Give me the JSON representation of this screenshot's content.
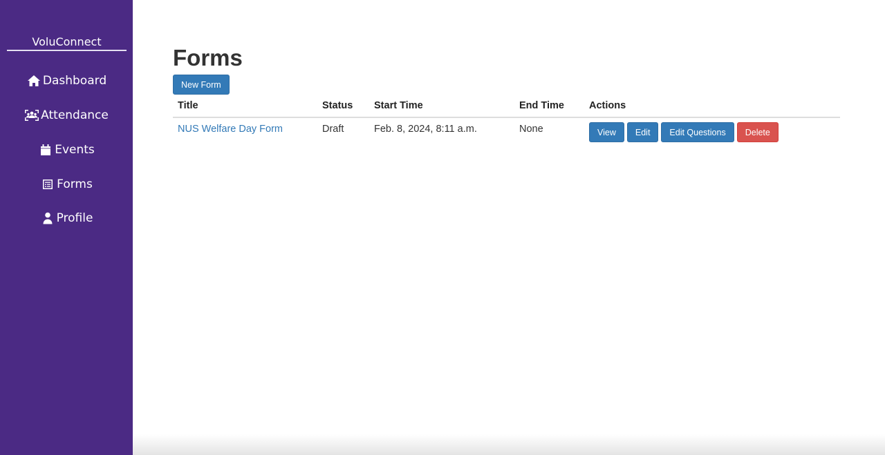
{
  "sidebar": {
    "brand": "VoluConnect",
    "items": [
      {
        "label": "Dashboard",
        "icon": "home-icon"
      },
      {
        "label": "Attendance",
        "icon": "users-icon"
      },
      {
        "label": "Events",
        "icon": "calendar-icon"
      },
      {
        "label": "Forms",
        "icon": "form-icon"
      },
      {
        "label": "Profile",
        "icon": "user-icon"
      }
    ]
  },
  "main": {
    "title": "Forms",
    "new_form_label": "New Form",
    "table": {
      "headers": [
        "Title",
        "Status",
        "Start Time",
        "End Time",
        "Actions"
      ],
      "rows": [
        {
          "title": "NUS Welfare Day Form",
          "status": "Draft",
          "start_time": "Feb. 8, 2024, 8:11 a.m.",
          "end_time": "None",
          "actions": [
            "View",
            "Edit",
            "Edit Questions",
            "Delete"
          ]
        }
      ]
    }
  },
  "colors": {
    "sidebar_bg": "#4b2a84",
    "primary": "#337ab7",
    "danger": "#d9534f"
  }
}
